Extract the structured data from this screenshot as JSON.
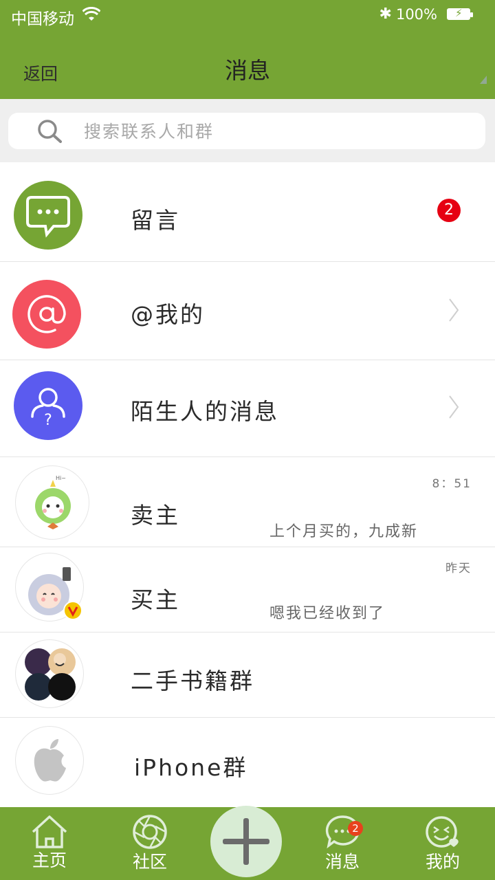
{
  "status_bar": {
    "carrier": "中国移动",
    "battery": "100%"
  },
  "header": {
    "back_label": "返回",
    "title": "消息"
  },
  "search": {
    "placeholder": "搜索联系人和群"
  },
  "items": [
    {
      "title": "留言",
      "badge": "2"
    },
    {
      "title": "@我的"
    },
    {
      "title": "陌生人的消息"
    },
    {
      "title": "卖主",
      "time": "8：51",
      "preview": "上个月买的，九成新"
    },
    {
      "title": "买主",
      "time": "昨天",
      "preview": "嗯我已经收到了"
    },
    {
      "title": "二手书籍群"
    },
    {
      "title": "iPhone群"
    }
  ],
  "tabbar": {
    "home": "主页",
    "community": "社区",
    "messages": "消息",
    "messages_badge": "2",
    "me": "我的"
  },
  "colors": {
    "brand": "#76a534",
    "message_icon_bg": "#76a534",
    "mention_icon_bg": "#f4515f",
    "stranger_icon_bg": "#5b5bef",
    "badge": "#e60012"
  }
}
